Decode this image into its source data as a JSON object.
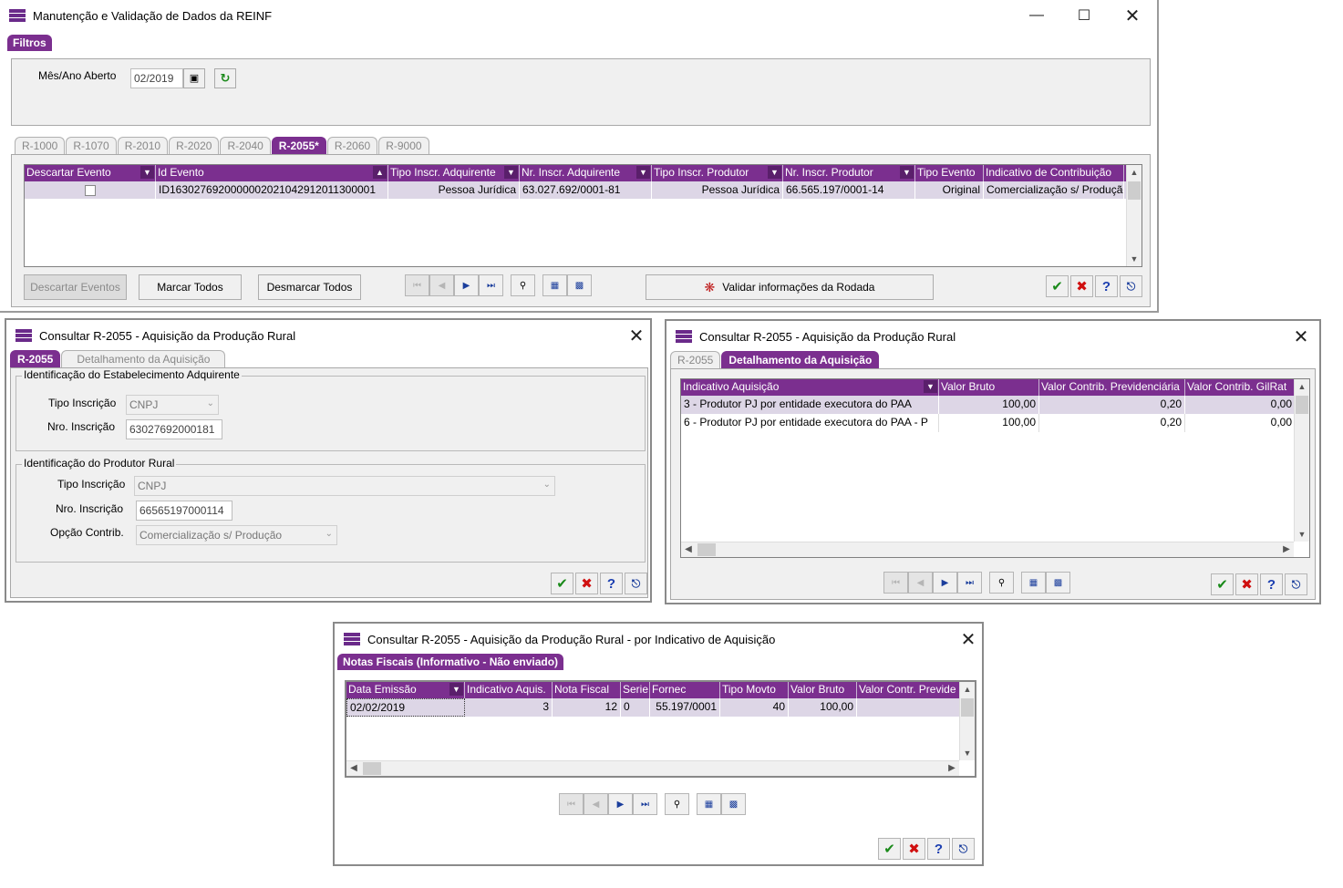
{
  "main": {
    "title": "Manutenção e Validação de Dados da REINF",
    "filters_tab": "Filtros",
    "mes_ano_label": "Mês/Ano Aberto",
    "mes_ano_value": "02/2019",
    "tabs": [
      "R-1000",
      "R-1070",
      "R-2010",
      "R-2020",
      "R-2040",
      "R-2055*",
      "R-2060",
      "R-9000"
    ],
    "active_tab": "R-2055*",
    "grid": {
      "columns": [
        "Descartar Evento",
        "Id Evento",
        "Tipo Inscr. Adquirente",
        "Nr. Inscr. Adquirente",
        "Tipo Inscr. Produtor",
        "Nr. Inscr. Produtor",
        "Tipo Evento",
        "Indicativo de Contribuição"
      ],
      "rows": [
        {
          "id_evento": "ID1630276920000002021042912011300001",
          "tipo_adq": "Pessoa Jurídica",
          "nr_adq": "63.027.692/0001-81",
          "tipo_prod": "Pessoa Jurídica",
          "nr_prod": "66.565.197/0001-14",
          "tipo_evento": "Original",
          "indicativo": "Comercialização s/ Produção"
        }
      ]
    },
    "buttons": {
      "descartar": "Descartar Eventos",
      "marcar": "Marcar Todos",
      "desmarcar": "Desmarcar Todos",
      "validar": "Validar informações da Rodada"
    }
  },
  "dlg1": {
    "title": "Consultar R-2055 - Aquisição da Produção Rural",
    "tabs": [
      "R-2055",
      "Detalhamento da Aquisição"
    ],
    "group1_title": "Identificação do Estabelecimento Adquirente",
    "tipo_inscricao_label": "Tipo Inscrição",
    "tipo_inscricao_value": "CNPJ",
    "nro_inscricao_label": "Nro. Inscrição",
    "nro_inscricao_value": "63027692000181",
    "group2_title": "Identificação do Produtor Rural",
    "prod_tipo_label": "Tipo Inscrição",
    "prod_tipo_value": "CNPJ",
    "prod_nro_label": "Nro. Inscrição",
    "prod_nro_value": "66565197000114",
    "opcao_label": "Opção Contrib.",
    "opcao_value": "Comercialização s/ Produção"
  },
  "dlg2": {
    "title": "Consultar R-2055 - Aquisição da Produção Rural",
    "tabs": [
      "R-2055",
      "Detalhamento da Aquisição"
    ],
    "columns": [
      "Indicativo Aquisição",
      "Valor Bruto",
      "Valor Contrib. Previdenciária",
      "Valor Contrib. GilRat"
    ],
    "rows": [
      [
        "3 - Produtor PJ por entidade executora do PAA",
        "100,00",
        "0,20",
        "0,00"
      ],
      [
        "6 - Produtor PJ por entidade executora do PAA - P",
        "100,00",
        "0,20",
        "0,00"
      ]
    ]
  },
  "dlg3": {
    "title": "Consultar R-2055 - Aquisição da Produção Rural - por Indicativo de Aquisição",
    "tab": "Notas Fiscais (Informativo - Não enviado)",
    "columns": [
      "Data Emissão",
      "Indicativo Aquis.",
      "Nota Fiscal",
      "Serie",
      "Fornec",
      "Tipo Movto",
      "Valor Bruto",
      "Valor Contr. Previde"
    ],
    "rows": [
      [
        "02/02/2019",
        "3",
        "12",
        "0",
        "55.197/0001",
        "40",
        "100,00",
        ""
      ]
    ]
  },
  "icons": {
    "ok": "✔",
    "cancel": "✖",
    "help": "?"
  }
}
